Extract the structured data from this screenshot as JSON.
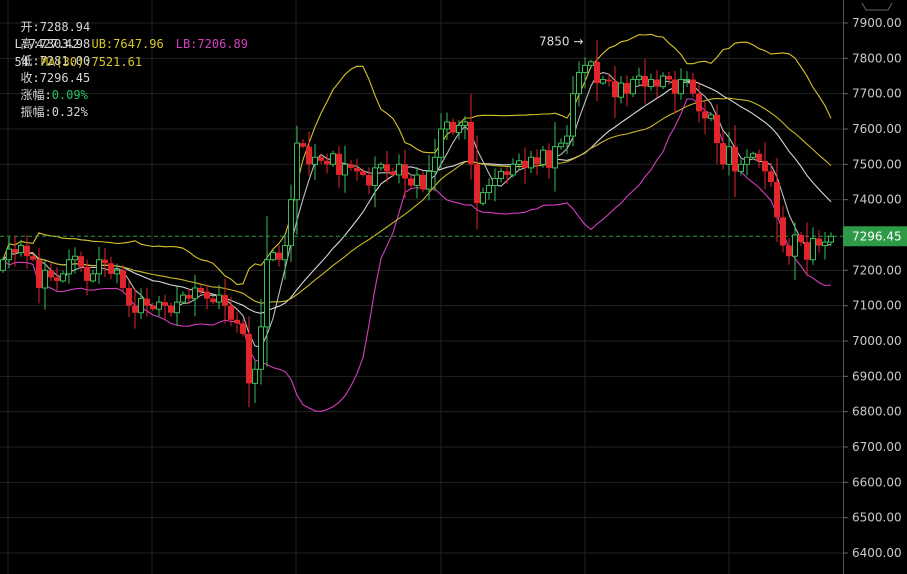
{
  "header": {
    "open_label": "开:",
    "open": "7288.94",
    "high_label": "高:",
    "high": "7303.98",
    "low_label": "低:",
    "low": "7281.00",
    "close_label": "收:",
    "close": "7296.45",
    "change_label": "涨幅:",
    "change": "0.09%",
    "amplitude_label": "振幅:",
    "amplitude": "0.32%",
    "boll_mid": "L:7427.42",
    "boll_ub": "UB:7647.96",
    "boll_lb": "LB:7206.89",
    "ma_partial": "54",
    "ma30": "MA(30):7521.61"
  },
  "colors": {
    "up": "#3dbb5a",
    "down": "#e0262a",
    "ub": "#d8c52a",
    "lb": "#d23fc0",
    "mid": "#d8d8d8",
    "ma": "#c8b828",
    "ma_short": "#bdbdbd",
    "price_tag": "#2e9a48",
    "change": "#22c55e"
  },
  "chart_data": {
    "type": "candlestick",
    "ylim": [
      6380,
      7960
    ],
    "y_ticks": [
      "7900.00",
      "7800.00",
      "7700.00",
      "7600.00",
      "7500.00",
      "7400.00",
      "7200.00",
      "7100.00",
      "7000.00",
      "6900.00",
      "6800.00",
      "6700.00",
      "6600.00",
      "6500.00",
      "6400.00"
    ],
    "y_tick_values": [
      7900,
      7800,
      7700,
      7600,
      7500,
      7400,
      7200,
      7100,
      7000,
      6900,
      6800,
      6700,
      6600,
      6500,
      6400
    ],
    "last_price": 7296.45,
    "last_price_label": "7296.45",
    "annotation": {
      "text": "7850 →",
      "value": 7850,
      "index": 96
    },
    "first_open": 7200,
    "closes": [
      7230,
      7260,
      7250,
      7270,
      7240,
      7230,
      7150,
      7200,
      7180,
      7170,
      7190,
      7230,
      7240,
      7210,
      7170,
      7190,
      7230,
      7220,
      7190,
      7200,
      7150,
      7100,
      7080,
      7120,
      7100,
      7090,
      7110,
      7100,
      7080,
      7110,
      7130,
      7120,
      7150,
      7140,
      7120,
      7110,
      7130,
      7100,
      7060,
      7050,
      7020,
      6880,
      6920,
      7040,
      7230,
      7250,
      7230,
      7270,
      7400,
      7560,
      7550,
      7500,
      7520,
      7510,
      7500,
      7530,
      7470,
      7500,
      7490,
      7480,
      7470,
      7440,
      7490,
      7500,
      7480,
      7470,
      7500,
      7460,
      7440,
      7470,
      7430,
      7480,
      7520,
      7600,
      7620,
      7590,
      7610,
      7620,
      7500,
      7390,
      7420,
      7440,
      7460,
      7480,
      7470,
      7500,
      7510,
      7490,
      7520,
      7500,
      7540,
      7490,
      7550,
      7560,
      7580,
      7700,
      7760,
      7780,
      7790,
      7730,
      7740,
      7735,
      7690,
      7730,
      7700,
      7740,
      7750,
      7720,
      7740,
      7720,
      7750,
      7740,
      7700,
      7740,
      7740,
      7700,
      7650,
      7630,
      7640,
      7560,
      7500,
      7550,
      7480,
      7500,
      7520,
      7530,
      7510,
      7480,
      7450,
      7350,
      7270,
      7240,
      7300,
      7280,
      7230,
      7290,
      7270,
      7280,
      7296.45
    ],
    "indicators": [
      "MA(5)",
      "MA(10)",
      "MA(30)",
      "BOLL(20,2)"
    ]
  }
}
